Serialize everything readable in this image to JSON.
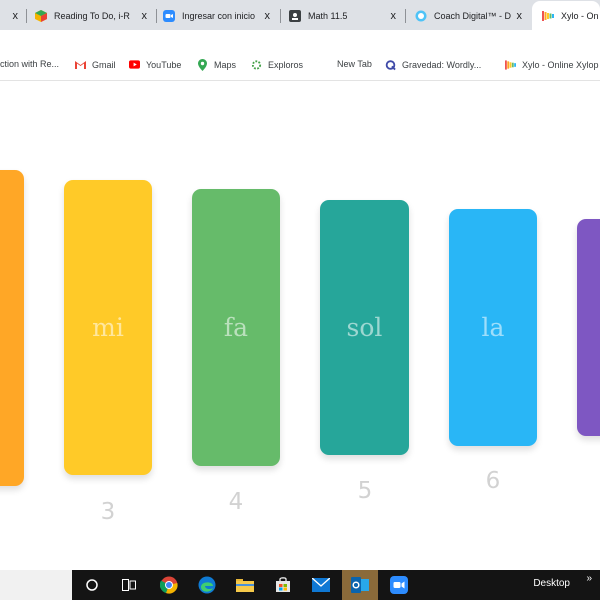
{
  "browser": {
    "tabs": [
      {
        "label": "",
        "icon": "close-icon"
      },
      {
        "label": "Reading To Do, i-R",
        "icon": "ireaddy-icon"
      },
      {
        "label": "Ingresar con inicio",
        "icon": "zoom-icon"
      },
      {
        "label": "Math 11.5",
        "icon": "classroom-icon"
      },
      {
        "label": "Coach Digital™ - D",
        "icon": "coach-icon"
      },
      {
        "label": "Xylo - On",
        "icon": "xylo-icon",
        "active": true
      }
    ],
    "close_glyph": "x",
    "bookmarks": [
      {
        "label": "ction with Re...",
        "icon": ""
      },
      {
        "label": "Gmail",
        "icon": "gmail-icon"
      },
      {
        "label": "YouTube",
        "icon": "youtube-icon"
      },
      {
        "label": "Maps",
        "icon": "maps-icon"
      },
      {
        "label": "Exploros",
        "icon": "exploros-icon"
      },
      {
        "label": "New Tab",
        "icon": ""
      },
      {
        "label": "Gravedad: Wordly...",
        "icon": "quizlet-icon"
      },
      {
        "label": "Xylo - Online Xylop",
        "icon": "xylo-icon"
      }
    ]
  },
  "xylophone": {
    "bars": [
      {
        "note": "",
        "number": "",
        "color": "#ffa726"
      },
      {
        "note": "mi",
        "number": "3",
        "color": "#ffca28"
      },
      {
        "note": "fa",
        "number": "4",
        "color": "#66bb6a"
      },
      {
        "note": "sol",
        "number": "5",
        "color": "#26a69a"
      },
      {
        "note": "la",
        "number": "6",
        "color": "#29b6f6"
      },
      {
        "note": "",
        "number": "",
        "color": "#7e57c2"
      }
    ]
  },
  "taskbar": {
    "apps": [
      "search-circle-icon",
      "task-view-icon",
      "chrome-icon",
      "edge-icon",
      "file-explorer-icon",
      "store-icon",
      "mail-icon",
      "outlook-icon",
      "zoom-icon"
    ],
    "desktop_label": "Desktop",
    "chevron": "»"
  }
}
